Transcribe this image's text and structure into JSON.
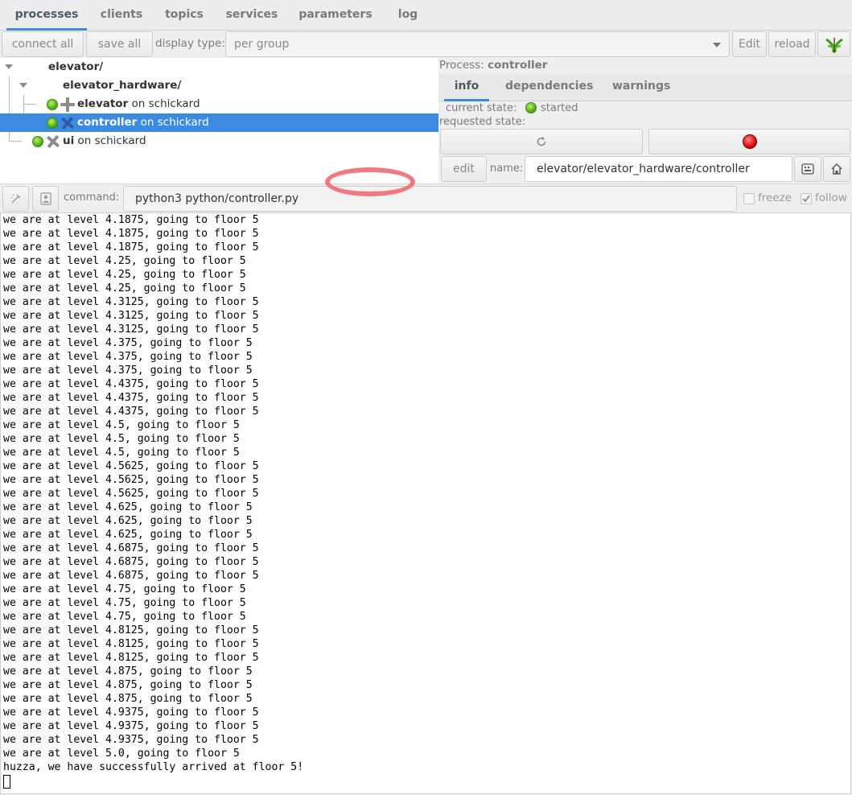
{
  "tabs": [
    {
      "label": "processes",
      "active": true
    },
    {
      "label": "clients",
      "active": false
    },
    {
      "label": "topics",
      "active": false
    },
    {
      "label": "services",
      "active": false
    },
    {
      "label": "parameters",
      "active": false
    },
    {
      "label": "log",
      "active": false
    }
  ],
  "toolbar": {
    "connect_all": "connect all",
    "save_all": "save all",
    "display_type_label": "display type:",
    "display_type_value": "per group",
    "edit": "Edit",
    "reload": "reload",
    "logo_icon": "mosquito-logo-icon"
  },
  "tree": {
    "group": "elevator/",
    "subgroup": "elevator_hardware/",
    "items": [
      {
        "name": "elevator",
        "host": " on schickard",
        "selected": false,
        "state": "started"
      },
      {
        "name": "controller",
        "host": " on schickard",
        "selected": true,
        "state": "started"
      },
      {
        "name": "ui",
        "host": " on schickard",
        "selected": false,
        "state": "started"
      }
    ]
  },
  "panel": {
    "process_label": "Process:",
    "process_name": "controller",
    "tabs": [
      {
        "label": "info",
        "active": true
      },
      {
        "label": "dependencies",
        "active": false
      },
      {
        "label": "warnings",
        "active": false
      }
    ],
    "current_state_label": "current state:",
    "current_state": "started",
    "requested_state_label": "requested state:",
    "restart_icon": "restart-icon",
    "stop_icon": "stop-red-icon",
    "edit": "edit",
    "name_label": "name:",
    "name_value": "elevator/elevator_hardware/controller"
  },
  "cmdbar": {
    "command_label": "command:",
    "command_value": "python3 python/controller.py",
    "freeze": "freeze",
    "follow": "follow",
    "freeze_checked": false,
    "follow_checked": true
  },
  "console": {
    "lines": [
      "we are at level 4.1875, going to floor 5",
      "we are at level 4.1875, going to floor 5",
      "we are at level 4.1875, going to floor 5",
      "we are at level 4.25, going to floor 5",
      "we are at level 4.25, going to floor 5",
      "we are at level 4.25, going to floor 5",
      "we are at level 4.3125, going to floor 5",
      "we are at level 4.3125, going to floor 5",
      "we are at level 4.3125, going to floor 5",
      "we are at level 4.375, going to floor 5",
      "we are at level 4.375, going to floor 5",
      "we are at level 4.375, going to floor 5",
      "we are at level 4.4375, going to floor 5",
      "we are at level 4.4375, going to floor 5",
      "we are at level 4.4375, going to floor 5",
      "we are at level 4.5, going to floor 5",
      "we are at level 4.5, going to floor 5",
      "we are at level 4.5, going to floor 5",
      "we are at level 4.5625, going to floor 5",
      "we are at level 4.5625, going to floor 5",
      "we are at level 4.5625, going to floor 5",
      "we are at level 4.625, going to floor 5",
      "we are at level 4.625, going to floor 5",
      "we are at level 4.625, going to floor 5",
      "we are at level 4.6875, going to floor 5",
      "we are at level 4.6875, going to floor 5",
      "we are at level 4.6875, going to floor 5",
      "we are at level 4.75, going to floor 5",
      "we are at level 4.75, going to floor 5",
      "we are at level 4.75, going to floor 5",
      "we are at level 4.8125, going to floor 5",
      "we are at level 4.8125, going to floor 5",
      "we are at level 4.8125, going to floor 5",
      "we are at level 4.875, going to floor 5",
      "we are at level 4.875, going to floor 5",
      "we are at level 4.875, going to floor 5",
      "we are at level 4.9375, going to floor 5",
      "we are at level 4.9375, going to floor 5",
      "we are at level 4.9375, going to floor 5",
      "we are at level 5.0, going to floor 5",
      "huzza, we have successfully arrived at floor 5!"
    ]
  },
  "colors": {
    "accent": "#3d8be0",
    "state_started": "#52b01a",
    "stop": "#e01010",
    "annotation": "#f0737a"
  }
}
